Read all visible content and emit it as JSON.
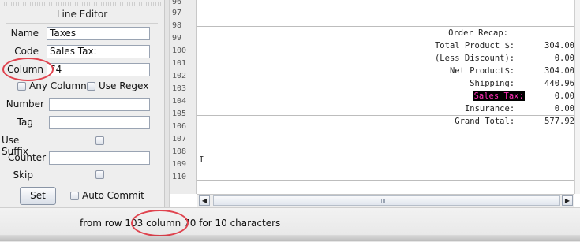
{
  "line_editor": {
    "title": "Line Editor",
    "name_label": "Name",
    "name_value": "Taxes",
    "code_label": "Code",
    "code_value": "Sales Tax:",
    "column_label": "Column",
    "column_value": "74",
    "any_column_label": "Any Column",
    "use_regex_label": "Use Regex",
    "number_label": "Number",
    "number_value": "",
    "tag_label": "Tag",
    "tag_value": "",
    "use_suffix_label": "Use Suffix",
    "counter_label": "Counter",
    "counter_value": "",
    "skip_label": "Skip",
    "set_label": "Set",
    "auto_commit_label": "Auto Commit"
  },
  "gutter": {
    "line_numbers": [
      "96",
      "97",
      "98",
      "99",
      "100",
      "101",
      "102",
      "103",
      "104",
      "105",
      "106",
      "107",
      "108",
      "109",
      "110"
    ]
  },
  "text": {
    "l98": "Order Recap:",
    "l99": "Total Product $:      304.00",
    "l100": "(Less Discount):        0.00",
    "l101": "Net Product$:      304.00",
    "l102": "Shipping:      440.96",
    "l103_label": "Sales Tax:",
    "l103_value": "      0.00",
    "l104": "Insurance:        0.00",
    "l105": "Grand Total:      577.92",
    "l108_cursor": "I"
  },
  "status": {
    "message": "from row 103 column 70 for 10 characters"
  },
  "colors": {
    "annotation_ring": "#e0434e",
    "highlight_fg": "#ff2fb8",
    "highlight_bg": "#000000"
  }
}
